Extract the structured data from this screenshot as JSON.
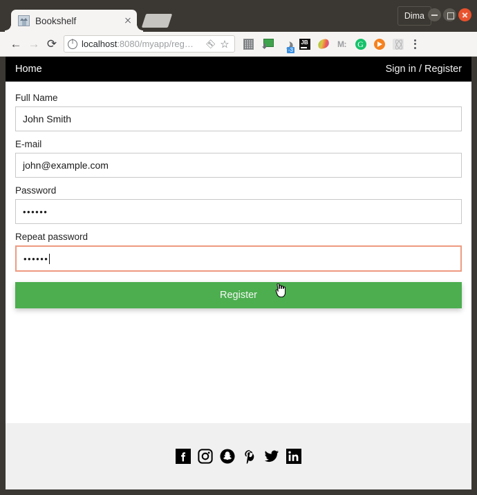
{
  "window": {
    "user_button": "Dima",
    "minimize_label": "Minimize",
    "maximize_label": "Maximize",
    "close_label": "Close"
  },
  "browser": {
    "tab": {
      "title": "Bookshelf",
      "favicon": "broken-image-icon",
      "close_label": "×"
    },
    "new_tab_label": "New tab",
    "toolbar": {
      "back": "←",
      "forward": "→",
      "reload": "⟳",
      "info_icon": "info-icon",
      "url_host": "localhost",
      "url_rest": ":8080/myapp/reg…",
      "key_icon": "key-icon",
      "star_icon": "star-icon",
      "menu_icon": "three-dot-menu-icon"
    },
    "extensions": [
      {
        "name": "qr-code-extension",
        "label": ""
      },
      {
        "name": "remote-desktop-extension",
        "label": ""
      },
      {
        "name": "night-mode-extension",
        "label": "",
        "badge": "-3"
      },
      {
        "name": "jetbrains-extension",
        "label": "JB"
      },
      {
        "name": "colorful-bird-extension",
        "label": ""
      },
      {
        "name": "momentum-extension",
        "label": "M:"
      },
      {
        "name": "grammarly-extension",
        "label": "G"
      },
      {
        "name": "player-extension",
        "label": ""
      },
      {
        "name": "react-devtools-extension",
        "label": ""
      }
    ]
  },
  "page": {
    "navbar": {
      "home": "Home",
      "signin_register": "Sign in / Register"
    },
    "form": {
      "fields": [
        {
          "label": "Full Name",
          "value": "John Smith",
          "type": "text",
          "error": false
        },
        {
          "label": "E-mail",
          "value": "john@example.com",
          "type": "email",
          "error": false
        },
        {
          "label": "Password",
          "value": "••••••",
          "type": "password",
          "error": false
        },
        {
          "label": "Repeat password",
          "value": "••••••",
          "type": "password",
          "error": true
        }
      ],
      "submit_label": "Register"
    },
    "footer": {
      "social": [
        {
          "name": "facebook-icon",
          "label": "Facebook"
        },
        {
          "name": "instagram-icon",
          "label": "Instagram"
        },
        {
          "name": "snapchat-icon",
          "label": "Snapchat"
        },
        {
          "name": "pinterest-icon",
          "label": "Pinterest"
        },
        {
          "name": "twitter-icon",
          "label": "Twitter"
        },
        {
          "name": "linkedin-icon",
          "label": "LinkedIn"
        }
      ]
    }
  },
  "colors": {
    "navbar_bg": "#000000",
    "submit_green": "#4cae4f",
    "error_border": "#ee9a80",
    "footer_bg": "#f0f0f0",
    "window_frame": "#3b3833",
    "close_button": "#e8522d"
  }
}
